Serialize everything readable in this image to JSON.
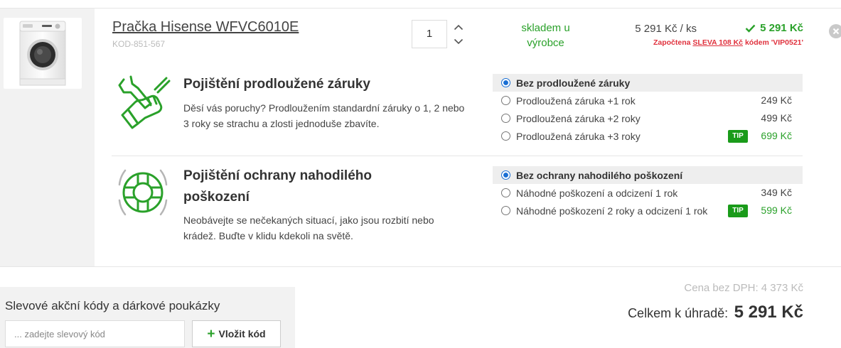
{
  "product": {
    "name": "Pračka Hisense WFVC6010E",
    "code": "KOD-851-567",
    "image_icon": "washing-machine-icon",
    "quantity": "1",
    "stock_line1": "skladem u",
    "stock_line2": "výrobce",
    "unit_price": "5 291 Kč / ks",
    "total_price": "5 291 Kč",
    "discount": {
      "prefix": "Započtena",
      "link": "SLEVA 108 Kč",
      "suffix": "kódem 'VIP0521'"
    }
  },
  "warranty": {
    "icon": "wrench-hand-icon",
    "title": "Pojištění prodloužené záruky",
    "description": "Děsí vás poruchy? Prodloužením standardní záruky o 1, 2 nebo 3 roky se strachu a zlosti jednoduše zbavíte.",
    "options": [
      {
        "label": "Bez prodloužené záruky",
        "price": "",
        "selected": true,
        "tip": ""
      },
      {
        "label": "Prodloužená záruka +1 rok",
        "price": "249 Kč",
        "selected": false,
        "tip": ""
      },
      {
        "label": "Prodloužená záruka +2 roky",
        "price": "499 Kč",
        "selected": false,
        "tip": ""
      },
      {
        "label": "Prodloužená záruka +3 roky",
        "price": "699 Kč",
        "selected": false,
        "tip": "TIP"
      }
    ]
  },
  "damage": {
    "icon": "lifebuoy-icon",
    "title": "Pojištění ochrany nahodilého poškození",
    "description": "Neobávejte se nečekaných situací, jako jsou rozbití nebo krádež. Buďte v klidu kdekoli na světě.",
    "options": [
      {
        "label": "Bez ochrany nahodilého poškození",
        "price": "",
        "selected": true,
        "tip": ""
      },
      {
        "label": "Náhodné poškození a odcizení 1 rok",
        "price": "349 Kč",
        "selected": false,
        "tip": ""
      },
      {
        "label": "Náhodné poškození 2 roky a odcizení 1 rok",
        "price": "599 Kč",
        "selected": false,
        "tip": "TIP"
      }
    ]
  },
  "coupon": {
    "label": "Slevové akční kódy a dárkové poukázky",
    "placeholder": "... zadejte slevový kód",
    "button": "Vložit kód"
  },
  "summary": {
    "vat_label": "Cena bez DPH:",
    "vat_value": "4 373 Kč",
    "total_label": "Celkem k úhradě:",
    "total_value": "5 291 Kč"
  },
  "colors": {
    "accent_green": "#2aa12a",
    "tip_green": "#1a9b1a",
    "discount_red": "#e0313d",
    "radio_blue": "#1a6fd4"
  }
}
